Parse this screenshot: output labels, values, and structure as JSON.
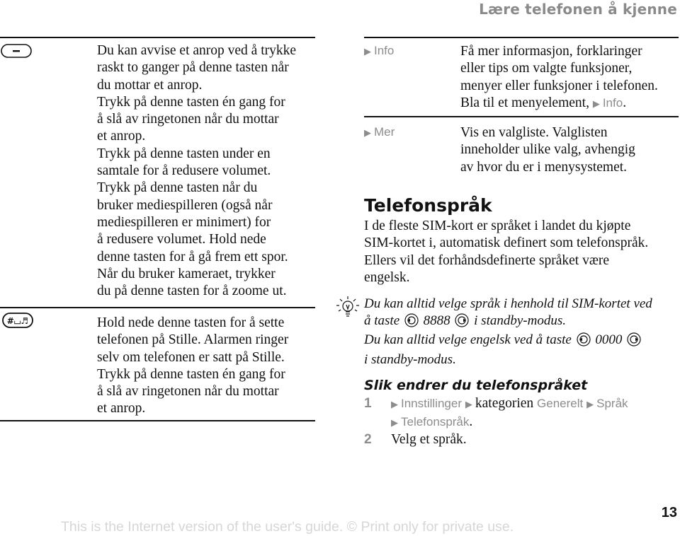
{
  "header": {
    "title": "Lære telefonen å kjenne"
  },
  "left_table": {
    "rows": [
      {
        "icon": "minus-key-icon",
        "lines": [
          "Du kan avvise et anrop ved å trykke",
          "raskt to ganger på denne tasten når",
          "du mottar et anrop.",
          "Trykk på denne tasten én gang for",
          "å slå av ringetonen når du mottar",
          "et anrop.",
          "Trykk på denne tasten under en",
          "samtale for å redusere volumet.",
          "Trykk på denne tasten når du",
          "bruker mediespilleren (også når",
          "mediespilleren er minimert) for",
          "å redusere volumet. Hold nede",
          "denne tasten for å gå frem ett spor.",
          "Når du bruker kameraet, trykker",
          "du på denne tasten for å zoome ut."
        ]
      },
      {
        "icon": "hash-silent-key-icon",
        "key_glyph": "#⌴♬",
        "lines": [
          "Hold nede denne tasten for å sette",
          "telefonen på Stille. Alarmen ringer",
          "selv om telefonen er satt på Stille.",
          "Trykk på denne tasten én gang for",
          "å slå av ringetonen når du mottar",
          "et anrop."
        ]
      }
    ]
  },
  "right_table": {
    "rows": [
      {
        "term": "Info",
        "lines": [
          "Få mer informasjon, forklaringer",
          "eller tips om valgte funksjoner,",
          "menyer eller funksjoner i telefonen."
        ],
        "last_line_prefix": "Bla til et menyelement, ",
        "last_line_link": "Info",
        "last_line_suffix": "."
      },
      {
        "term": "Mer",
        "lines": [
          "Vis en valgliste. Valglisten",
          "inneholder ulike valg, avhengig",
          "av hvor du er i menysystemet."
        ]
      }
    ]
  },
  "section": {
    "title": "Telefonspråk",
    "paragraph": [
      "I de fleste SIM-kort er språket i landet du kjøpte",
      "SIM-kortet i, automatisk definert som telefonspråk.",
      "Ellers vil det forhåndsdefinerte språket være",
      "engelsk."
    ]
  },
  "tip": {
    "icon": "lightbulb-icon",
    "line1": "Du kan alltid velge språk i henhold til SIM-kortet ved",
    "line2_prefix": "å taste",
    "line2_code": "8888",
    "line2_suffix": "i standby-modus.",
    "line3_prefix": "Du kan alltid velge engelsk ved å taste",
    "line3_code": "0000",
    "line4": "i standby-modus."
  },
  "procedure": {
    "title": "Slik endrer du telefonspråket",
    "steps": [
      {
        "number": "1",
        "menu1": "Innstillinger",
        "text1": "kategorien",
        "menu2": "Generelt",
        "menu3": "Språk",
        "menu4": "Telefonspråk",
        "suffix": "."
      },
      {
        "number": "2",
        "text": "Velg et språk."
      }
    ]
  },
  "footer": {
    "notice": "This is the Internet version of the user's guide. © Print only for private use.",
    "page_number": "13"
  },
  "colors": {
    "text": "#111111",
    "menu_gray": "#8c8c8c",
    "header_gray": "#8a8a8a",
    "footer_gray": "#d6d6d6"
  }
}
